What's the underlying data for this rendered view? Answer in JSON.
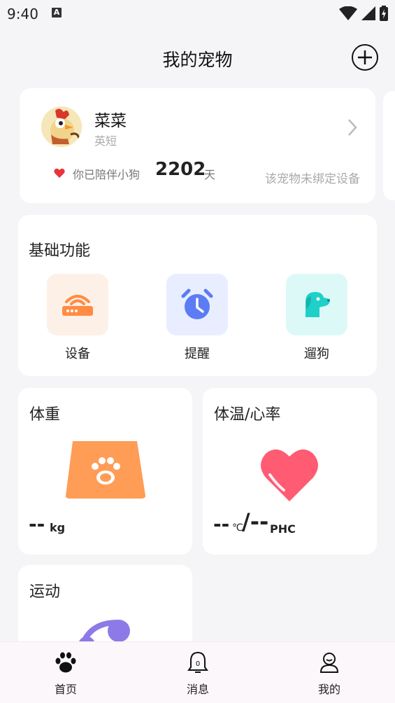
{
  "status_bar": {
    "time": "9:40",
    "notification_letter": "A"
  },
  "header": {
    "title": "我的宠物"
  },
  "pet": {
    "name": "菜菜",
    "breed": "英短",
    "companion_label": "你已陪伴小狗",
    "companion_days": "2202",
    "companion_unit": "天",
    "device_status": "该宠物未绑定设备"
  },
  "basic_functions": {
    "title": "基础功能",
    "items": [
      {
        "label": "设备",
        "icon": "router-icon",
        "bg": "#fdf0e6",
        "color": "#ff8c42"
      },
      {
        "label": "提醒",
        "icon": "alarm-clock-icon",
        "bg": "#e8eeff",
        "color": "#5b7cf5"
      },
      {
        "label": "遛狗",
        "icon": "dog-icon",
        "bg": "#dcf9f7",
        "color": "#1fd0c9"
      }
    ]
  },
  "weight": {
    "title": "体重",
    "value": "--",
    "unit": "kg"
  },
  "temperature": {
    "title": "体温/心率",
    "temp_value": "--",
    "temp_unit": "℃",
    "hr_value": "/--",
    "hr_unit": "PHC"
  },
  "sport": {
    "title": "运动"
  },
  "bottom_nav": [
    {
      "label": "首页",
      "icon": "paw-icon",
      "active": true
    },
    {
      "label": "消息",
      "icon": "bell-icon",
      "active": false
    },
    {
      "label": "我的",
      "icon": "user-icon",
      "active": false
    }
  ],
  "colors": {
    "accent_orange": "#ff9c56",
    "heart_red": "#ff5b73",
    "sport_purple": "#8e7ae6"
  }
}
